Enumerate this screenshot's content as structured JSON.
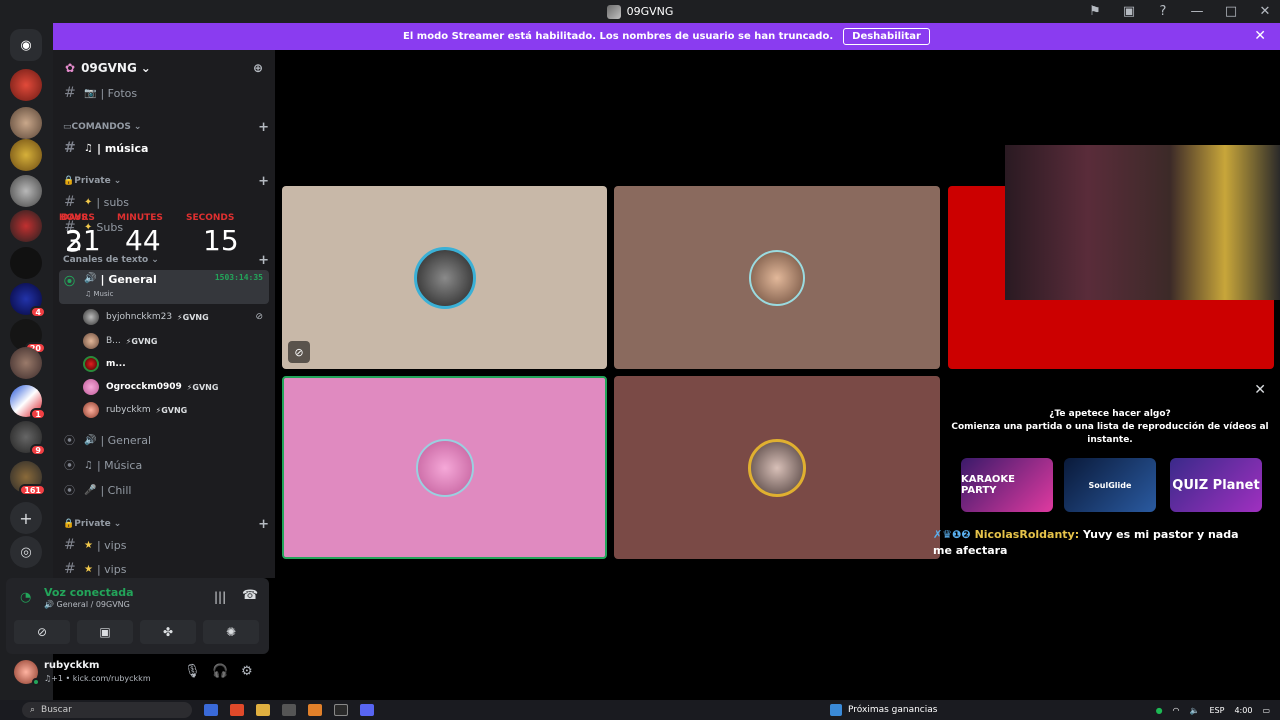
{
  "window": {
    "title": "09GVNG"
  },
  "banner": {
    "text": "El modo Streamer está habilitado. Los nombres de usuario se han truncado.",
    "button": "Deshabilitar"
  },
  "server": {
    "name": "09GVNG"
  },
  "channels": {
    "fotos": "Fotos",
    "cat_comandos": "COMANDOS",
    "musica_text": "música",
    "cat_private1": "Private",
    "subs": "subs",
    "subs2": "Subs",
    "cat_textos": "Canales de texto",
    "general_voice": "General",
    "general_timer": "1503:14:35",
    "general_status": "Music",
    "general1": "General",
    "musica_voice": "Música",
    "chill": "Chill",
    "cat_private2": "Private",
    "vips1": "vips",
    "vips2": "vips"
  },
  "countdown": {
    "days_label": "DAYS",
    "days": "3",
    "hours_label": "HOURS",
    "hours": "21",
    "minutes_label": "MINUTES",
    "minutes": "44",
    "seconds_label": "SECONDS",
    "seconds": "15"
  },
  "voice_users": [
    {
      "name": "byjohnckkm23",
      "tag": "⚡GVNG"
    },
    {
      "name": "B...",
      "tag": "⚡GVNG"
    },
    {
      "name": "m...",
      "tag": ""
    },
    {
      "name": "Ogrocckm0909",
      "tag": "⚡GVNG"
    },
    {
      "name": "rubyckkm",
      "tag": "⚡GVNG"
    }
  ],
  "guild_badges": [
    "4",
    "20",
    "1",
    "9",
    "161"
  ],
  "voice_panel": {
    "title": "Voz conectada",
    "subtitle": "General / 09GVNG"
  },
  "user_panel": {
    "name": "rubyckkm",
    "status": "♫+1 • kick.com/rubyckkm"
  },
  "activity": {
    "question": "¿Te apetece hacer algo?",
    "desc": "Comienza una partida o una lista de reproducción de vídeos al instante.",
    "cards": [
      "KARAOKE PARTY",
      "SoulGlide",
      "QUIZ Planet"
    ]
  },
  "chat": {
    "user": "NicolasRoldanty:",
    "message": "Yuvy es mi pastor y nada me afectara"
  },
  "taskbar": {
    "search": "Buscar",
    "news": "Próximas ganancias",
    "lang": "ESP",
    "time": "4:00"
  },
  "colors": {
    "banner": "#8a3cf0",
    "tile1": "#c8b8a8",
    "tile2": "#8a6a5e",
    "tile3": "#cc0000",
    "tile4": "#e08ac0",
    "tile5": "#7a4a46"
  }
}
